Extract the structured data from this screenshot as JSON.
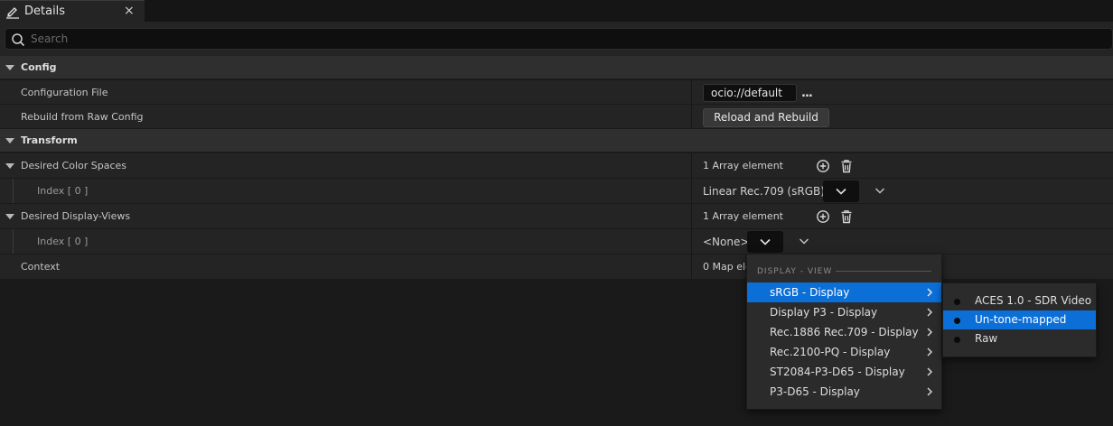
{
  "panel": {
    "tab_title": "Details",
    "close_glyph": "×",
    "search_placeholder": "Search"
  },
  "config": {
    "category": "Config",
    "configuration_file_label": "Configuration File",
    "configuration_file_value": "ocio://default",
    "browse_glyph": "...",
    "rebuild_label": "Rebuild from Raw Config",
    "rebuild_button": "Reload and Rebuild"
  },
  "transform": {
    "category": "Transform",
    "color_spaces_label": "Desired Color Spaces",
    "color_spaces_count": "1 Array element",
    "color_space_index_label": "Index [ 0 ]",
    "color_space_value": "Linear Rec.709 (sRGB)",
    "display_views_label": "Desired Display-Views",
    "display_views_count": "1 Array element",
    "display_view_index_label": "Index [ 0 ]",
    "display_view_value": "<None>",
    "context_label": "Context",
    "context_value": "0 Map ele"
  },
  "menu": {
    "header": "DISPLAY - VIEW",
    "items": [
      {
        "label": "sRGB - Display",
        "selected": true
      },
      {
        "label": "Display P3 - Display"
      },
      {
        "label": "Rec.1886 Rec.709 - Display"
      },
      {
        "label": "Rec.2100-PQ - Display"
      },
      {
        "label": "ST2084-P3-D65 - Display"
      },
      {
        "label": "P3-D65 - Display"
      }
    ]
  },
  "submenu": {
    "items": [
      {
        "label": "ACES 1.0 - SDR Video"
      },
      {
        "label": "Un-tone-mapped",
        "selected": true
      },
      {
        "label": "Raw"
      }
    ]
  },
  "colors": {
    "selection": "#0c6fd8",
    "panel": "#242424",
    "category": "#2f2f2f",
    "field": "#0f0f0f"
  },
  "icons": [
    "edit-icon",
    "close-icon",
    "search-icon",
    "collapse-arrow-icon",
    "add-element-icon",
    "delete-icon",
    "chevron-down-icon",
    "chevron-right-icon",
    "radio-dot-icon"
  ]
}
